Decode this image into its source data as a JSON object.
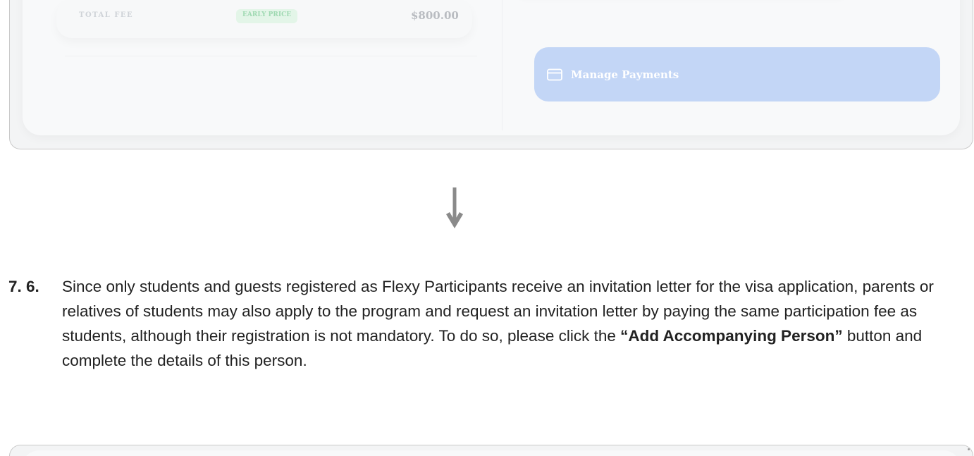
{
  "top_screenshot": {
    "fee_label": "TOTAL FEE",
    "fee_badge": "EARLY PRICE",
    "fee_amount": "$800.00",
    "manage_button": {
      "label": "Manage Payments",
      "icon": "credit-card-icon",
      "color": "#c3d6f6"
    }
  },
  "arrow": {
    "icon": "arrow-down-icon",
    "color": "#8a8a8a"
  },
  "step": {
    "number": "7. 6.",
    "text_before": "Since only students and guests registered as Flexy Participants receive an invitation letter for the visa application, parents or relatives of students may also apply to the program and request an invitation letter by paying the same participation fee as students, although their registration is not mandatory. To do so, please click the ",
    "button_name": "“Add Accompanying Person”",
    "text_after": " button and complete the details of this person."
  }
}
